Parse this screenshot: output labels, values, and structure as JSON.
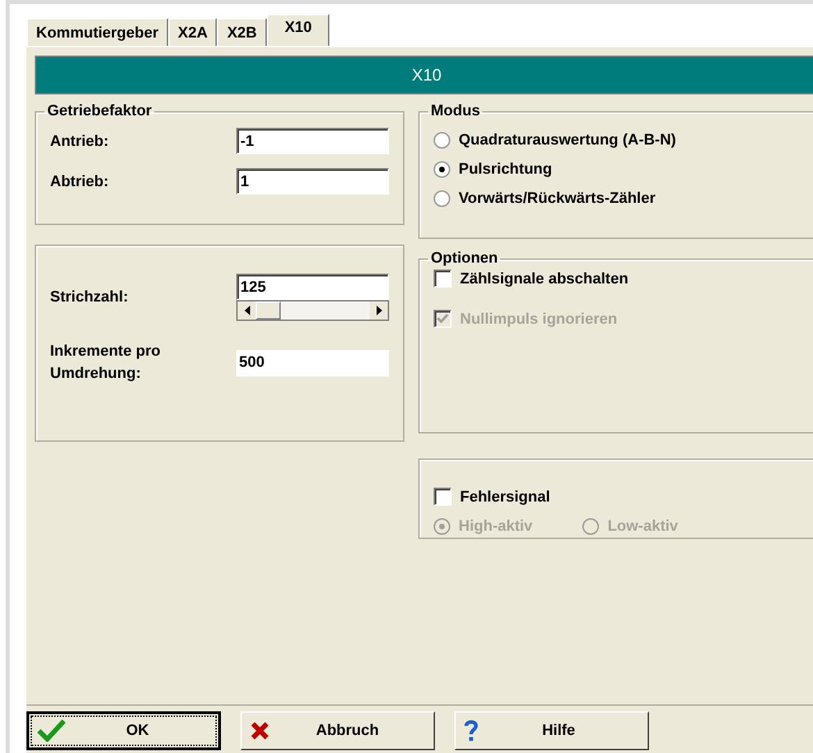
{
  "tabs": [
    {
      "label": "Kommutiergeber",
      "selected": false
    },
    {
      "label": "X2A",
      "selected": false
    },
    {
      "label": "X2B",
      "selected": false
    },
    {
      "label": "X10",
      "selected": true
    }
  ],
  "header": "X10",
  "gear_group": {
    "title": "Getriebefaktor",
    "fields": [
      {
        "label": "Antrieb:",
        "value": "-1"
      },
      {
        "label": "Abtrieb:",
        "value": "1"
      }
    ]
  },
  "encoder_group": {
    "strichzahl": {
      "label": "Strichzahl:",
      "value": "125"
    },
    "increments": {
      "label": "Inkremente pro Umdrehung:",
      "value": "500"
    }
  },
  "mode_group": {
    "title": "Modus",
    "options": [
      {
        "label": "Quadraturauswertung (A-B-N)",
        "selected": false
      },
      {
        "label": "Pulsrichtung",
        "selected": true
      },
      {
        "label": "Vorwärts/Rückwärts-Zähler",
        "selected": false
      }
    ]
  },
  "options_group": {
    "title": "Optionen",
    "items": [
      {
        "label": "Zählsignale abschalten",
        "checked": false,
        "disabled": false
      },
      {
        "label": "Nullimpuls ignorieren",
        "checked": true,
        "disabled": true
      }
    ]
  },
  "error_group": {
    "checkbox": {
      "label": "Fehlersignal",
      "checked": false,
      "disabled": false
    },
    "levels": [
      {
        "label": "High-aktiv",
        "selected": true,
        "disabled": true
      },
      {
        "label": "Low-aktiv",
        "selected": false,
        "disabled": true
      }
    ]
  },
  "buttons": [
    {
      "kind": "ok",
      "label": "OK",
      "focused": true
    },
    {
      "kind": "cancel",
      "label": "Abbruch",
      "focused": false
    },
    {
      "kind": "help",
      "label": "Hilfe",
      "focused": false
    }
  ]
}
